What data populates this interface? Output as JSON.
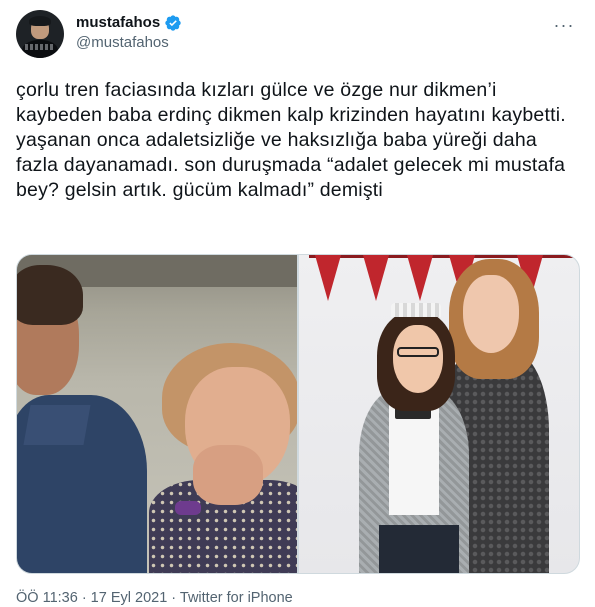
{
  "tweet": {
    "author": {
      "display_name": "mustafahos",
      "handle": "@mustafahos",
      "verified": true,
      "verified_color": "#1d9bf0"
    },
    "more_icon": "more-horizontal-icon",
    "text": "çorlu tren faciasında kızları gülce ve özge nur dikmen’i kaybeden baba erdinç dikmen kalp krizinden hayatını kaybetti. yaşanan onca adaletsizliğe ve haksızlığa baba yüreği daha fazla dayanamadı. son duruşmada “adalet gelecek mi mustafa bey? gelsin artık. gücüm kalmadı” demişti",
    "meta": {
      "time": "ÖÖ 11:36 · 17 Eyl 2021",
      "separator": " · ",
      "source": "Twitter for iPhone"
    }
  },
  "colors": {
    "text_primary": "#0f1419",
    "text_secondary": "#536471",
    "border": "#cfd9de",
    "bunting_red": "#c0262d"
  }
}
